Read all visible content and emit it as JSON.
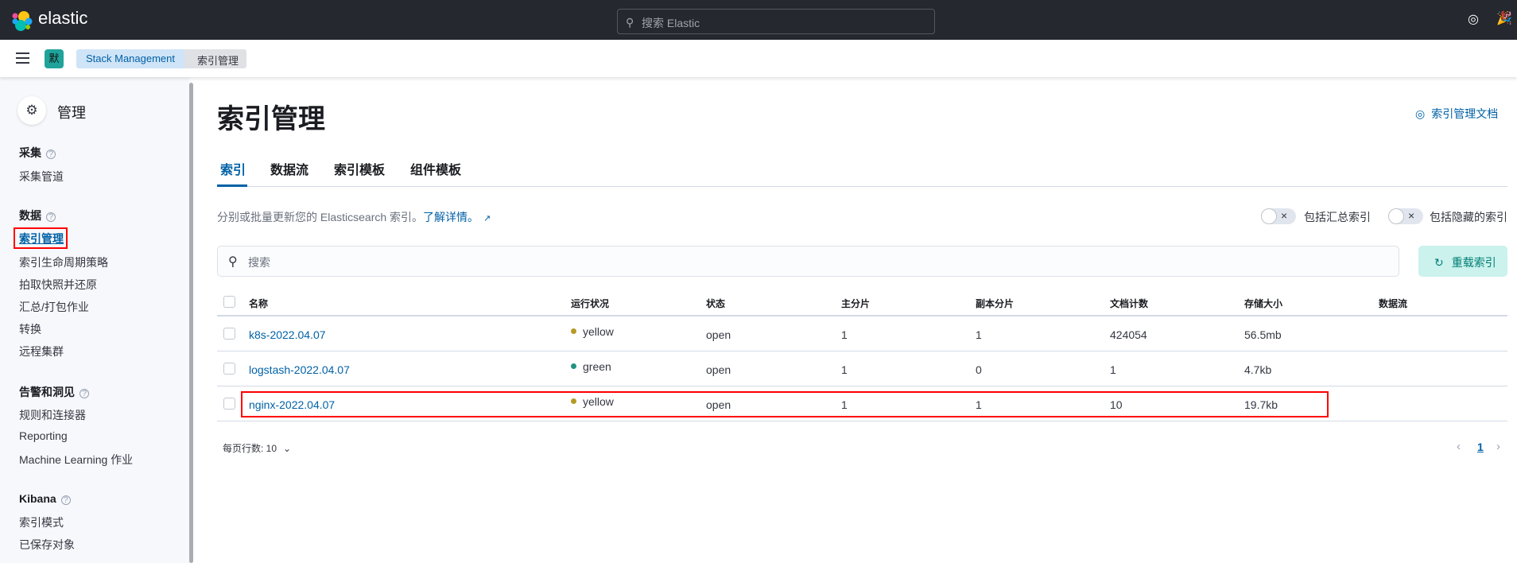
{
  "topbar": {
    "brand": "elastic",
    "search_placeholder": "搜索 Elastic"
  },
  "breadcrumb": {
    "space_initial": "默",
    "items": [
      "Stack Management",
      "索引管理"
    ]
  },
  "sidebar": {
    "title": "管理",
    "sections": [
      {
        "heading": "采集",
        "items": [
          "采集管道"
        ]
      },
      {
        "heading": "数据",
        "items": [
          "索引管理",
          "索引生命周期策略",
          "拍取快照并还原",
          "汇总/打包作业",
          "转换",
          "远程集群"
        ]
      },
      {
        "heading": "告警和洞见",
        "items": [
          "规则和连接器",
          "Reporting",
          "Machine Learning 作业"
        ]
      },
      {
        "heading": "Kibana",
        "items": [
          "索引模式",
          "已保存对象"
        ]
      }
    ],
    "active": "索引管理"
  },
  "main": {
    "title": "索引管理",
    "docs_link": "索引管理文档",
    "tabs": [
      "索引",
      "数据流",
      "索引模板",
      "组件模板"
    ],
    "description": "分别或批量更新您的 Elasticsearch 索引。",
    "learn_more": "了解详情。",
    "toggles": [
      "包括汇总索引",
      "包括隐藏的索引"
    ],
    "search_placeholder": "搜索",
    "reload_label": "重载索引",
    "table": {
      "headers": [
        "名称",
        "运行状况",
        "状态",
        "主分片",
        "副本分片",
        "文档计数",
        "存储大小",
        "数据流"
      ],
      "rows": [
        {
          "name": "k8s-2022.04.07",
          "health": "yellow",
          "health_color": "#b79a26",
          "status": "open",
          "primary": "1",
          "replica": "1",
          "docs": "424054",
          "size": "56.5mb",
          "stream": ""
        },
        {
          "name": "logstash-2022.04.07",
          "health": "green",
          "health_color": "#209280",
          "status": "open",
          "primary": "1",
          "replica": "0",
          "docs": "1",
          "size": "4.7kb",
          "stream": ""
        },
        {
          "name": "nginx-2022.04.07",
          "health": "yellow",
          "health_color": "#b79a26",
          "status": "open",
          "primary": "1",
          "replica": "1",
          "docs": "10",
          "size": "19.7kb",
          "stream": ""
        }
      ]
    },
    "rows_per_page": "每页行数: 10",
    "current_page": "1"
  }
}
